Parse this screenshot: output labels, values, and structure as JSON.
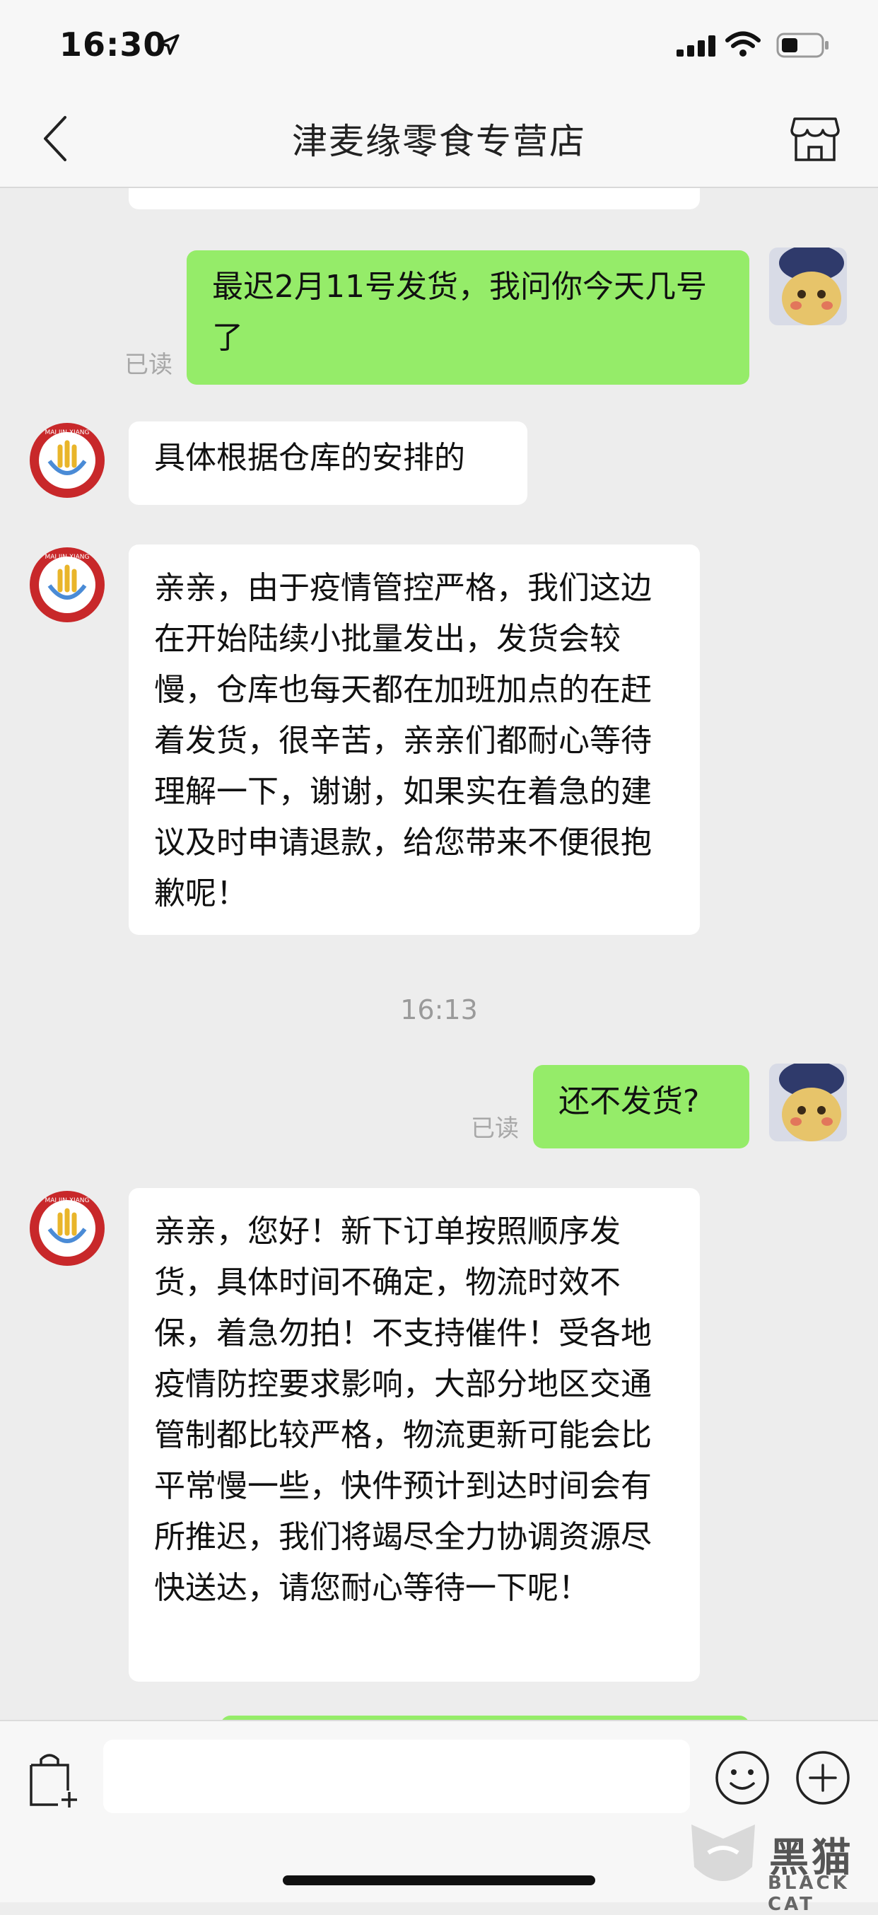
{
  "status_bar": {
    "time": "16:30",
    "icons": [
      "location-arrow-icon",
      "signal-icon",
      "wifi-icon",
      "battery-icon"
    ]
  },
  "nav": {
    "title": "津麦缘零食专营店",
    "back_icon": "chevron-left-icon",
    "store_icon": "storefront-icon"
  },
  "chat": {
    "messages": [
      {
        "from": "customer",
        "text": "最迟2月11号发货，我问你今天几号了",
        "read_label": "已读"
      },
      {
        "from": "shop",
        "text": "具体根据仓库的安排的"
      },
      {
        "from": "shop",
        "text": "亲亲，由于疫情管控严格，我们这边在开始陆续小批量发出，发货会较慢，仓库也每天都在加班加点的在赶着发货，很辛苦，亲亲们都耐心等待理解一下，谢谢，如果实在着急的建议及时申请退款，给您带来不便很抱歉呢！"
      },
      {
        "from": "customer",
        "text": "还不发货?",
        "read_label": "已读"
      },
      {
        "from": "shop",
        "text": "亲亲，您好！新下订单按照顺序发货，具体时间不确定，物流时效不保，着急勿拍！不支持催件！受各地疫情防控要求影响，大部分地区交通管制都比较严格，物流更新可能会比平常慢一些，快件预计到达时间会有所推迟，我们将竭尽全力协调资源尽快送达，请您耐心等待一下呢！"
      }
    ],
    "timestamp": "16:13",
    "shop_logo_text": "MAI JIN XIANG"
  },
  "input_bar": {
    "placeholder": "",
    "icons": [
      "shopping-bag-plus-icon",
      "emoji-icon",
      "plus-circle-icon"
    ]
  },
  "watermark": {
    "main": "黑猫",
    "sub": "BLACK CAT"
  },
  "colors": {
    "outgoing_bubble": "#95ec69",
    "incoming_bubble": "#ffffff",
    "background": "#ededed"
  }
}
